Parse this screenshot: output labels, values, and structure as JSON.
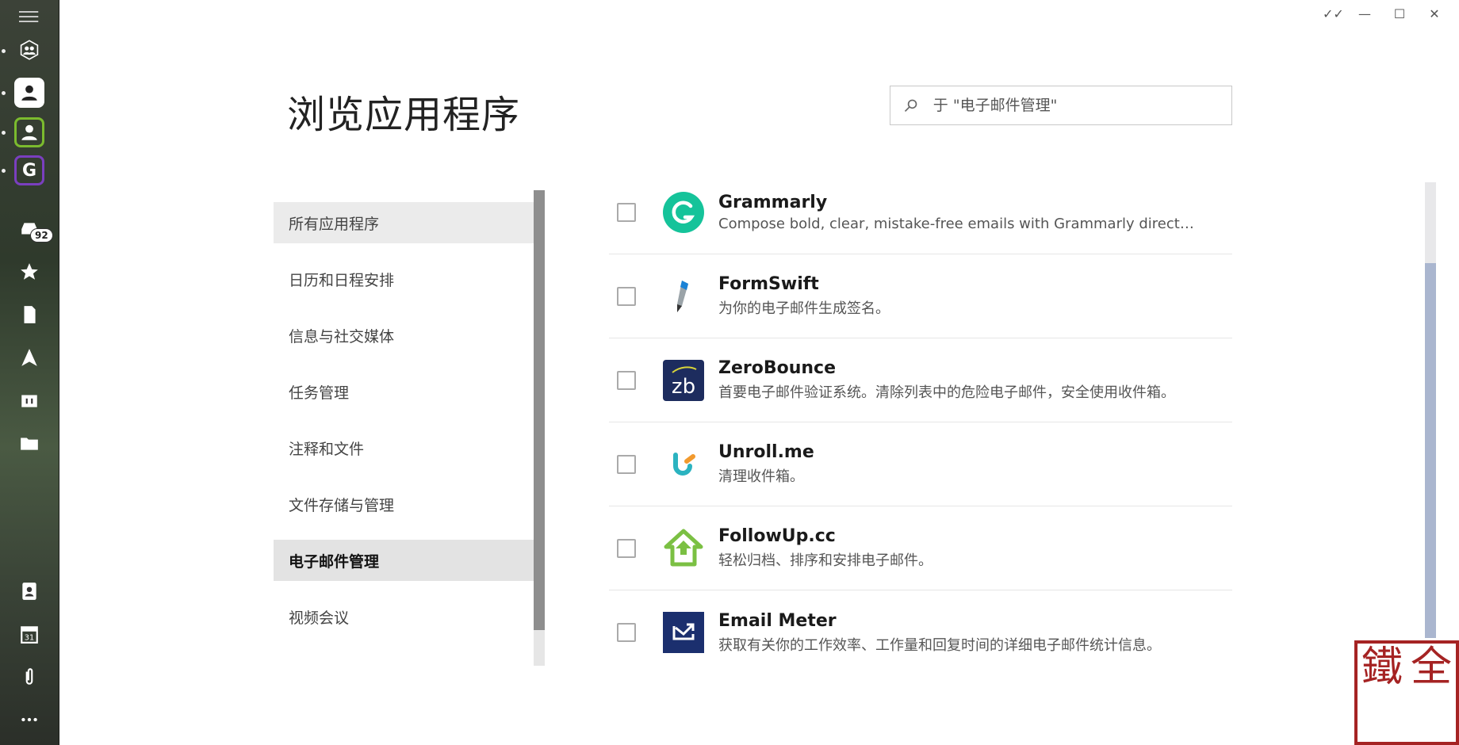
{
  "rail": {
    "badge_count": "92",
    "account_letter": "G"
  },
  "window": {
    "done_all": "✓✓",
    "minimize": "—",
    "maximize": "☐",
    "close": "✕"
  },
  "header": {
    "title": "浏览应用程序",
    "search_placeholder": "于 \"电子邮件管理\""
  },
  "categories": [
    {
      "label": "所有应用程序"
    },
    {
      "label": "日历和日程安排"
    },
    {
      "label": "信息与社交媒体"
    },
    {
      "label": "任务管理"
    },
    {
      "label": "注释和文件"
    },
    {
      "label": "文件存储与管理"
    },
    {
      "label": "电子邮件管理"
    },
    {
      "label": "视频会议"
    }
  ],
  "apps": [
    {
      "name": "Grammarly",
      "desc": "Compose bold, clear, mistake-free emails with Grammarly directly f..."
    },
    {
      "name": "FormSwift",
      "desc": "为你的电子邮件生成签名。"
    },
    {
      "name": "ZeroBounce",
      "desc": "首要电子邮件验证系统。清除列表中的危险电子邮件，安全使用收件箱。",
      "logo_text": "zb"
    },
    {
      "name": "Unroll.me",
      "desc": "清理收件箱。"
    },
    {
      "name": "FollowUp.cc",
      "desc": "轻松归档、排序和安排电子邮件。"
    },
    {
      "name": "Email Meter",
      "desc": "获取有关你的工作效率、工作量和回复时间的详细电子邮件统计信息。"
    }
  ],
  "seal": [
    "鐵",
    "全",
    "",
    ""
  ],
  "colors": {
    "grammarly": "#15c39a",
    "zerobounce": "#1d2c5e",
    "followup": "#7bc043",
    "emailmeter": "#1b2f6e",
    "scroll_thumb": "#aab6cf",
    "seal_red": "#a52323"
  }
}
